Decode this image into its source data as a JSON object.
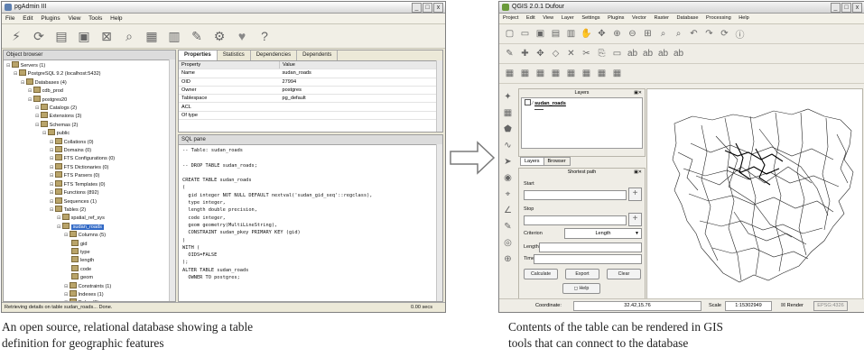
{
  "pgadmin": {
    "title": "pgAdmin III",
    "window_buttons": [
      "_",
      "□",
      "x"
    ],
    "menu": [
      "File",
      "Edit",
      "Plugins",
      "View",
      "Tools",
      "Help"
    ],
    "toolbar_icons": [
      "connect-icon",
      "refresh-icon",
      "properties-icon",
      "create-icon",
      "delete-icon",
      "query-icon",
      "view-data-icon",
      "filter-icon",
      "maintenance-icon",
      "plugins-icon",
      "hint-icon",
      "help-icon"
    ],
    "browser_header": "Object browser",
    "tree": [
      {
        "label": "Servers (1)",
        "indent": 0
      },
      {
        "label": "PostgreSQL 9.2 (localhost:5432)",
        "indent": 1
      },
      {
        "label": "Databases (4)",
        "indent": 2
      },
      {
        "label": "cdb_prod",
        "indent": 3
      },
      {
        "label": "postgres20",
        "indent": 3
      },
      {
        "label": "Catalogs (2)",
        "indent": 4
      },
      {
        "label": "Extensions (3)",
        "indent": 4
      },
      {
        "label": "Schemas (2)",
        "indent": 4
      },
      {
        "label": "public",
        "indent": 5
      },
      {
        "label": "Collations (0)",
        "indent": 6
      },
      {
        "label": "Domains (0)",
        "indent": 6
      },
      {
        "label": "FTS Configurations (0)",
        "indent": 6
      },
      {
        "label": "FTS Dictionaries (0)",
        "indent": 6
      },
      {
        "label": "FTS Parsers (0)",
        "indent": 6
      },
      {
        "label": "FTS Templates (0)",
        "indent": 6
      },
      {
        "label": "Functions (892)",
        "indent": 6
      },
      {
        "label": "Sequences (1)",
        "indent": 6
      },
      {
        "label": "Tables (2)",
        "indent": 6
      },
      {
        "label": "spatial_ref_sys",
        "indent": 7
      },
      {
        "label": "sudan_roads",
        "indent": 7,
        "selected": true
      },
      {
        "label": "Columns (5)",
        "indent": 8
      },
      {
        "label": "gid",
        "indent": 9
      },
      {
        "label": "type",
        "indent": 9
      },
      {
        "label": "length",
        "indent": 9
      },
      {
        "label": "code",
        "indent": 9
      },
      {
        "label": "geom",
        "indent": 9
      },
      {
        "label": "Constraints (1)",
        "indent": 8
      },
      {
        "label": "Indexes (1)",
        "indent": 8
      },
      {
        "label": "Rules (0)",
        "indent": 8
      },
      {
        "label": "Triggers (0)",
        "indent": 8
      }
    ],
    "tabs": [
      "Properties",
      "Statistics",
      "Dependencies",
      "Dependents"
    ],
    "props_header": {
      "property": "Property",
      "value": "Value"
    },
    "properties": [
      {
        "property": "Name",
        "value": "sudan_roads"
      },
      {
        "property": "OID",
        "value": "27994"
      },
      {
        "property": "Owner",
        "value": "postgres"
      },
      {
        "property": "Tablespace",
        "value": "pg_default"
      },
      {
        "property": "ACL",
        "value": ""
      },
      {
        "property": "Of type",
        "value": ""
      }
    ],
    "sql_header": "SQL pane",
    "sql": "-- Table: sudan_roads\n\n-- DROP TABLE sudan_roads;\n\nCREATE TABLE sudan_roads\n(\n  gid integer NOT NULL DEFAULT nextval('sudan_gid_seq'::regclass),\n  type integer,\n  length double precision,\n  code integer,\n  geom geometry(MultiLineString),\n  CONSTRAINT sudan_pkey PRIMARY KEY (gid)\n)\nWITH (\n  OIDS=FALSE\n);\nALTER TABLE sudan_roads\n  OWNER TO postgres;",
    "status_left": "Retrieving details on table sudan_roads... Done.",
    "status_right": "0.00 secs"
  },
  "qgis": {
    "title": "QGIS 2.0.1 Dufour",
    "window_buttons": [
      "_",
      "□",
      "x"
    ],
    "menu": [
      "Project",
      "Edit",
      "View",
      "Layer",
      "Settings",
      "Plugins",
      "Vector",
      "Raster",
      "Database",
      "Processing",
      "Help"
    ],
    "layers_header": "Layers",
    "layer_name": "sudan_roads",
    "panel_tabs": [
      "Layers",
      "Browser"
    ],
    "shortest_path_header": "Shortest path",
    "start_label": "Start",
    "stop_label": "Stop",
    "criterion_label": "Criterion",
    "criterion_value": "Length",
    "length_label": "Length",
    "time_label": "Time",
    "buttons": [
      "Calculate",
      "Export",
      "Clear"
    ],
    "help_button": "Help",
    "coordinate_label": "Coordinate:",
    "coordinate_value": "32.42,15.76",
    "scale_label": "Scale",
    "scale_value": "1:15302949",
    "render_label": "Render",
    "crs_label": "EPSG:4326"
  },
  "captions": {
    "left": [
      "An open source, relational database showing a table",
      "definition for geographic features"
    ],
    "right": [
      "Contents of the table can be rendered in GIS",
      "tools that can connect to the database"
    ]
  },
  "colors": {
    "selection": "#3169c6",
    "chrome": "#ece9d8",
    "map_line": "#222222"
  }
}
